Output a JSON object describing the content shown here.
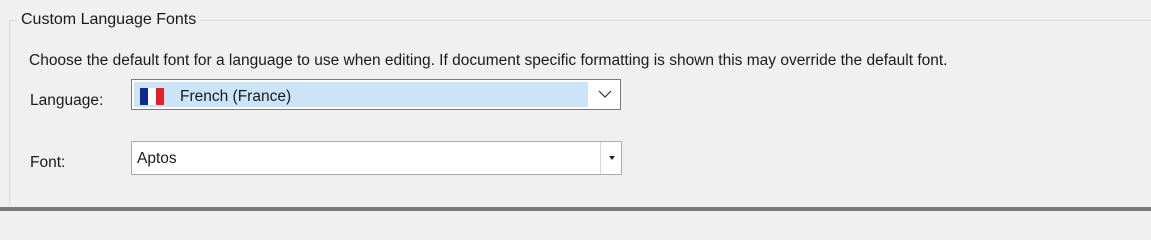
{
  "group": {
    "title": "Custom Language Fonts",
    "description": "Choose the default font for a language to use when editing. If document specific formatting is shown this may override the default font."
  },
  "language": {
    "label": "Language:",
    "value": "French (France)",
    "flag_icon": "france-flag-icon",
    "flag_colors": [
      "#0b2b8f",
      "#ffffff",
      "#e0202b"
    ],
    "dropdown_icon": "chevron-down-icon"
  },
  "font": {
    "label": "Font:",
    "value": "Aptos",
    "dropdown_icon": "caret-down-icon"
  }
}
